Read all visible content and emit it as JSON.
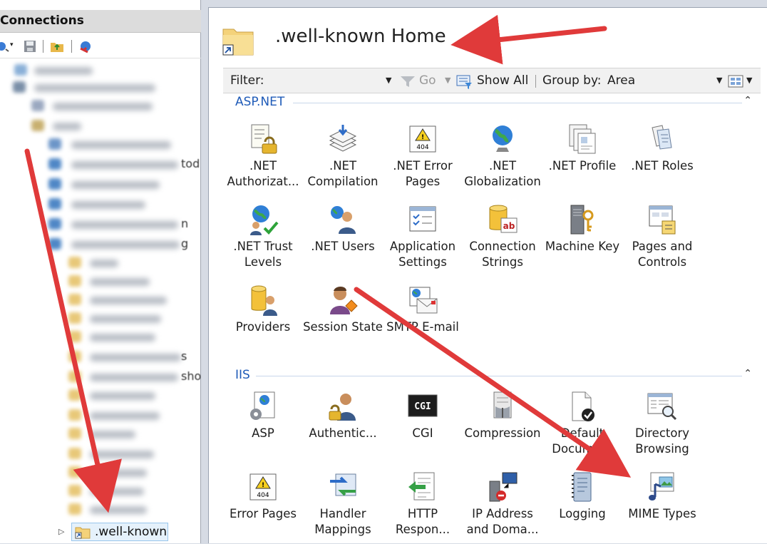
{
  "connections": {
    "title": "Connections",
    "toolbar": [
      {
        "icon": "connect-icon"
      },
      {
        "icon": "save-icon"
      },
      {
        "icon": "up-folder-icon"
      },
      {
        "icon": "disconnect-icon"
      }
    ],
    "peek_texts": [
      "tod",
      "n",
      "g",
      "s",
      "sho"
    ],
    "selected_node": {
      "label": ".well-known",
      "icon": "folder-shortcut-icon",
      "expander": "▷"
    }
  },
  "home": {
    "title": ".well-known Home",
    "icon": "folder-shortcut-icon"
  },
  "filter_bar": {
    "filter_label": "Filter:",
    "filter_value": "",
    "go_label": "Go",
    "show_all_label": "Show All",
    "group_by_label": "Group by:",
    "group_by_value": "Area",
    "view_icon": "view-mode-icon"
  },
  "sections": [
    {
      "title": "ASP.NET",
      "items": [
        {
          "label": ".NET\nAuthorizat...",
          "icon": "net-authorization-icon"
        },
        {
          "label": ".NET\nCompilation",
          "icon": "net-compilation-icon"
        },
        {
          "label": ".NET Error\nPages",
          "icon": "net-error-pages-icon"
        },
        {
          "label": ".NET\nGlobalization",
          "icon": "net-globalization-icon"
        },
        {
          "label": ".NET Profile",
          "icon": "net-profile-icon"
        },
        {
          "label": ".NET Roles",
          "icon": "net-roles-icon"
        },
        {
          "label": ".NET Trust\nLevels",
          "icon": "net-trust-levels-icon"
        },
        {
          "label": ".NET Users",
          "icon": "net-users-icon"
        },
        {
          "label": "Application\nSettings",
          "icon": "application-settings-icon"
        },
        {
          "label": "Connection\nStrings",
          "icon": "connection-strings-icon"
        },
        {
          "label": "Machine Key",
          "icon": "machine-key-icon"
        },
        {
          "label": "Pages and\nControls",
          "icon": "pages-controls-icon"
        },
        {
          "label": "Providers",
          "icon": "providers-icon"
        },
        {
          "label": "Session State",
          "icon": "session-state-icon"
        },
        {
          "label": "SMTP E-mail",
          "icon": "smtp-email-icon"
        }
      ]
    },
    {
      "title": "IIS",
      "items": [
        {
          "label": "ASP",
          "icon": "asp-icon"
        },
        {
          "label": "Authentic...",
          "icon": "authentication-icon"
        },
        {
          "label": "CGI",
          "icon": "cgi-icon"
        },
        {
          "label": "Compression",
          "icon": "compression-icon"
        },
        {
          "label": "Default\nDocument",
          "icon": "default-document-icon"
        },
        {
          "label": "Directory\nBrowsing",
          "icon": "directory-browsing-icon"
        },
        {
          "label": "Error Pages",
          "icon": "error-pages-icon"
        },
        {
          "label": "Handler\nMappings",
          "icon": "handler-mappings-icon"
        },
        {
          "label": "HTTP\nRespon...",
          "icon": "http-response-icon"
        },
        {
          "label": "IP Address\nand Doma...",
          "icon": "ip-address-icon"
        },
        {
          "label": "Logging",
          "icon": "logging-icon"
        },
        {
          "label": "MIME Types",
          "icon": "mime-types-icon"
        }
      ]
    }
  ],
  "colors": {
    "section_title": "#1f5bb8",
    "arrow": "#e03a3a",
    "selection_bg": "#e5f1fb",
    "selection_border": "#98c5ec",
    "folder": "#f4d27a"
  }
}
